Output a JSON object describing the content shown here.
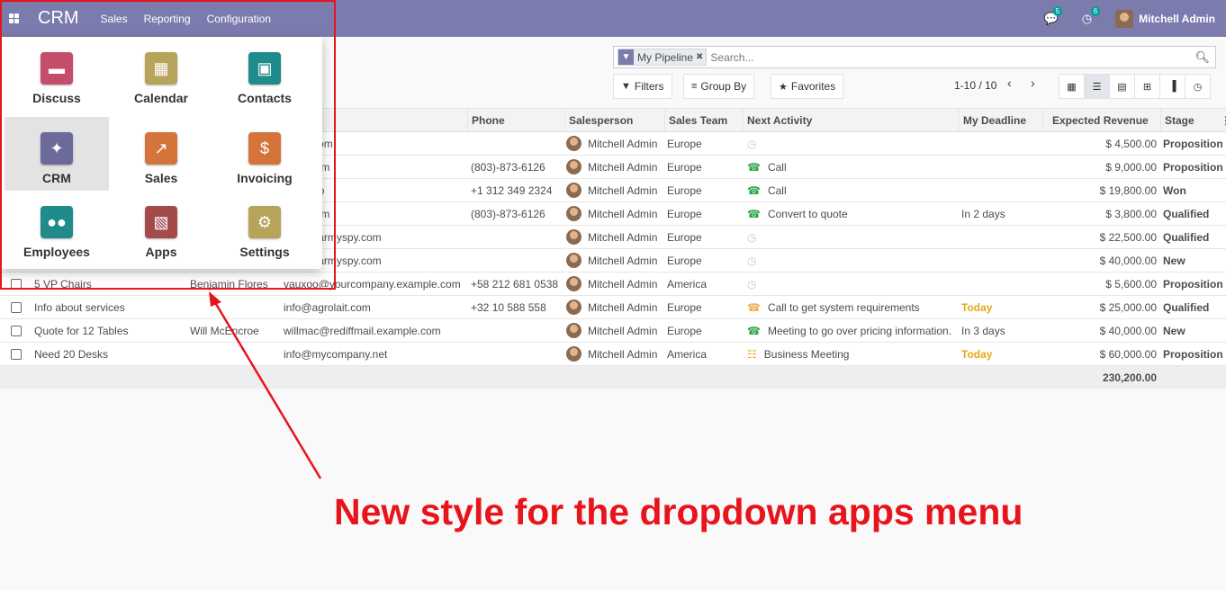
{
  "navbar": {
    "brand": "CRM",
    "menus": [
      "Sales",
      "Reporting",
      "Configuration"
    ],
    "messages_badge": "5",
    "activities_badge": "6",
    "user_name": "Mitchell Admin",
    "color": "#7c7bad"
  },
  "search": {
    "facet_label": "My Pipeline",
    "placeholder": "Search..."
  },
  "buttons": {
    "filters": "Filters",
    "group_by": "Group By",
    "favorites": "Favorites"
  },
  "pager": {
    "value": "1-10 / 10"
  },
  "columns": {
    "phone": "Phone",
    "salesperson": "Salesperson",
    "sales_team": "Sales Team",
    "next_activity": "Next Activity",
    "my_deadline": "My Deadline",
    "expected_revenue": "Expected Revenue",
    "stage": "Stage"
  },
  "rows": [
    {
      "opportunity": "",
      "contact": "",
      "email": "elight.com",
      "phone": "",
      "salesperson": "Mitchell Admin",
      "team": "Europe",
      "activity": "",
      "activity_icon": "clock",
      "deadline": "",
      "revenue": "$ 4,500.00",
      "stage": "Proposition"
    },
    {
      "opportunity": "",
      "contact": "",
      "email": "ltabc.com",
      "phone": "(803)-873-6126",
      "salesperson": "Mitchell Admin",
      "team": "Europe",
      "activity": "Call",
      "activity_icon": "phone",
      "deadline": "",
      "revenue": "$ 9,000.00",
      "stage": "Proposition"
    },
    {
      "opportunity": "",
      "contact": "",
      "email": "tech.info",
      "phone": "+1 312 349 2324",
      "salesperson": "Mitchell Admin",
      "team": "Europe",
      "activity": "Call",
      "activity_icon": "phone",
      "deadline": "",
      "revenue": "$ 19,800.00",
      "stage": "Won"
    },
    {
      "opportunity": "",
      "contact": "",
      "email": "ltabc.com",
      "phone": "(803)-873-6126",
      "salesperson": "Mitchell Admin",
      "team": "Europe",
      "activity": "Convert to quote",
      "activity_icon": "phone",
      "deadline": "In 2 days",
      "revenue": "$ 3,800.00",
      "stage": "Qualified"
    },
    {
      "opportunity": "",
      "contact": "",
      "email": "ench@armyspy.com",
      "phone": "",
      "salesperson": "Mitchell Admin",
      "team": "Europe",
      "activity": "",
      "activity_icon": "clock",
      "deadline": "",
      "revenue": "$ 22,500.00",
      "stage": "Qualified"
    },
    {
      "opportunity": "",
      "contact": "",
      "email": "ench@armyspy.com",
      "phone": "",
      "salesperson": "Mitchell Admin",
      "team": "Europe",
      "activity": "",
      "activity_icon": "clock",
      "deadline": "",
      "revenue": "$ 40,000.00",
      "stage": "New"
    },
    {
      "opportunity": "5 VP Chairs",
      "contact": "Benjamin Flores",
      "email": "vauxoo@yourcompany.example.com",
      "phone": "+58 212 681 0538",
      "salesperson": "Mitchell Admin",
      "team": "America",
      "activity": "",
      "activity_icon": "clock",
      "deadline": "",
      "revenue": "$ 5,600.00",
      "stage": "Proposition"
    },
    {
      "opportunity": "Info about services",
      "contact": "",
      "email": "info@agrolait.com",
      "phone": "+32 10 588 558",
      "salesperson": "Mitchell Admin",
      "team": "Europe",
      "activity": "Call to get system requirements",
      "activity_icon": "phone-orange",
      "deadline": "Today",
      "revenue": "$ 25,000.00",
      "stage": "Qualified"
    },
    {
      "opportunity": "Quote for 12 Tables",
      "contact": "Will McEncroe",
      "email": "willmac@rediffmail.example.com",
      "phone": "",
      "salesperson": "Mitchell Admin",
      "team": "Europe",
      "activity": "Meeting to go over pricing information.",
      "activity_icon": "phone",
      "deadline": "In 3 days",
      "revenue": "$ 40,000.00",
      "stage": "New"
    },
    {
      "opportunity": "Need 20 Desks",
      "contact": "",
      "email": "info@mycompany.net",
      "phone": "",
      "salesperson": "Mitchell Admin",
      "team": "America",
      "activity": "Business Meeting",
      "activity_icon": "meeting",
      "deadline": "Today",
      "revenue": "$ 60,000.00",
      "stage": "Proposition"
    }
  ],
  "total_revenue": "230,200.00",
  "apps": [
    {
      "label": "Discuss",
      "color": "#c44d6b",
      "icon": "chat-icon"
    },
    {
      "label": "Calendar",
      "color": "#b8a35b",
      "icon": "calendar-icon"
    },
    {
      "label": "Contacts",
      "color": "#1f8b8a",
      "icon": "contacts-icon"
    },
    {
      "label": "CRM",
      "color": "#6b6a9a",
      "icon": "handshake-icon"
    },
    {
      "label": "Sales",
      "color": "#d4743b",
      "icon": "chart-icon"
    },
    {
      "label": "Invoicing",
      "color": "#d4743b",
      "icon": "invoice-icon"
    },
    {
      "label": "Employees",
      "color": "#1f8b8a",
      "icon": "people-icon"
    },
    {
      "label": "Apps",
      "color": "#a34a4a",
      "icon": "cubes-icon"
    },
    {
      "label": "Settings",
      "color": "#b8a35b",
      "icon": "gear-icon"
    }
  ],
  "annotation": {
    "text": "New style for the dropdown apps menu",
    "color": "#e8141c"
  }
}
